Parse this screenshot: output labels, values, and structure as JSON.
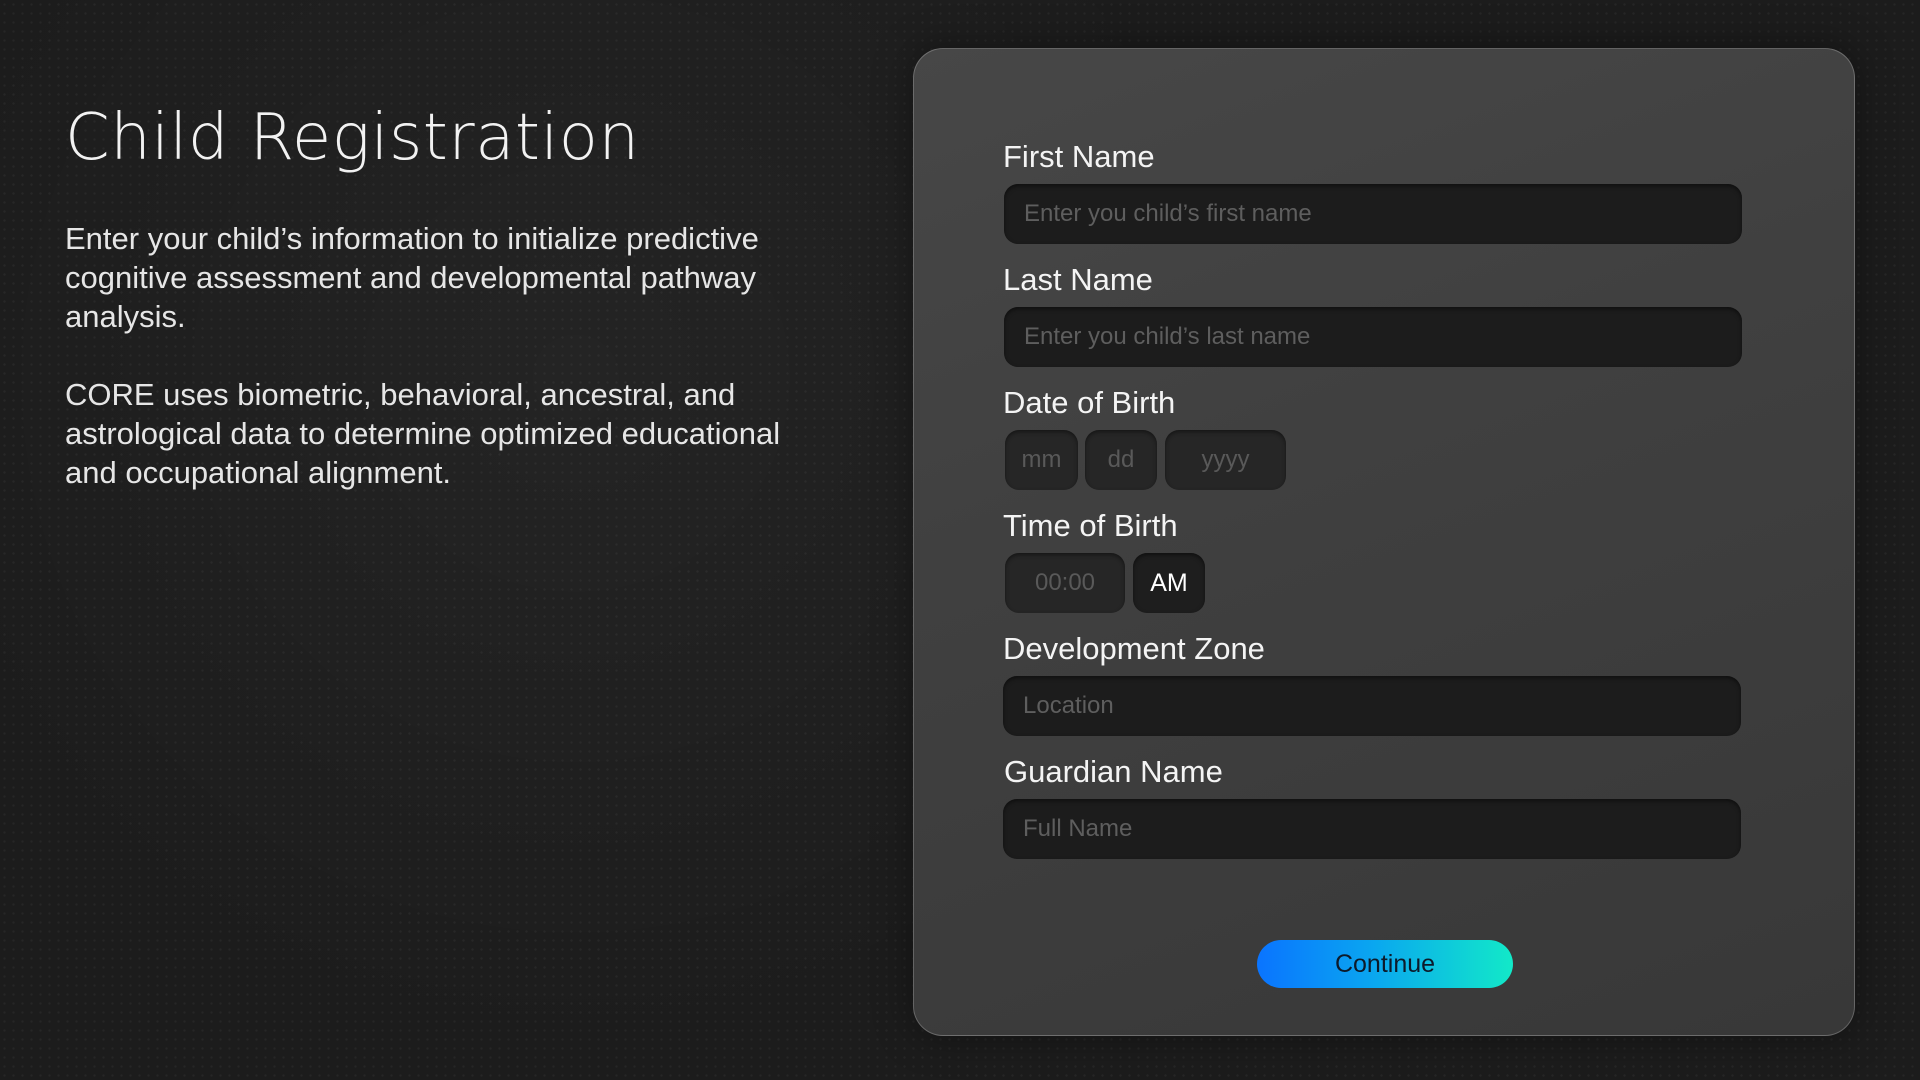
{
  "intro": {
    "title": "Child Registration",
    "paragraph1": "Enter your child’s information to initialize predictive cognitive assessment and developmental pathway analysis.",
    "paragraph2": "CORE uses biometric, behavioral, ancestral, and astrological data to determine optimized educational and occupational alignment."
  },
  "form": {
    "first_name": {
      "label": "First Name",
      "value": "",
      "placeholder": "Enter you child’s first name"
    },
    "last_name": {
      "label": "Last Name",
      "value": "",
      "placeholder": "Enter you child’s last name"
    },
    "date_of_birth": {
      "label": "Date of Birth",
      "month_placeholder": "mm",
      "day_placeholder": "dd",
      "year_placeholder": "yyyy"
    },
    "time_of_birth": {
      "label": "Time of Birth",
      "time_placeholder": "00:00",
      "period": "AM"
    },
    "development_zone": {
      "label": "Development Zone",
      "value": "",
      "placeholder": "Location"
    },
    "guardian_name": {
      "label": "Guardian Name",
      "value": "",
      "placeholder": "Full Name"
    },
    "continue_label": "Continue"
  },
  "colors": {
    "background": "#1c1c1c",
    "panel": "#424242",
    "input": "#1c1c1c",
    "button_gradient_start": "#0a74ff",
    "button_gradient_end": "#12e9c8"
  }
}
